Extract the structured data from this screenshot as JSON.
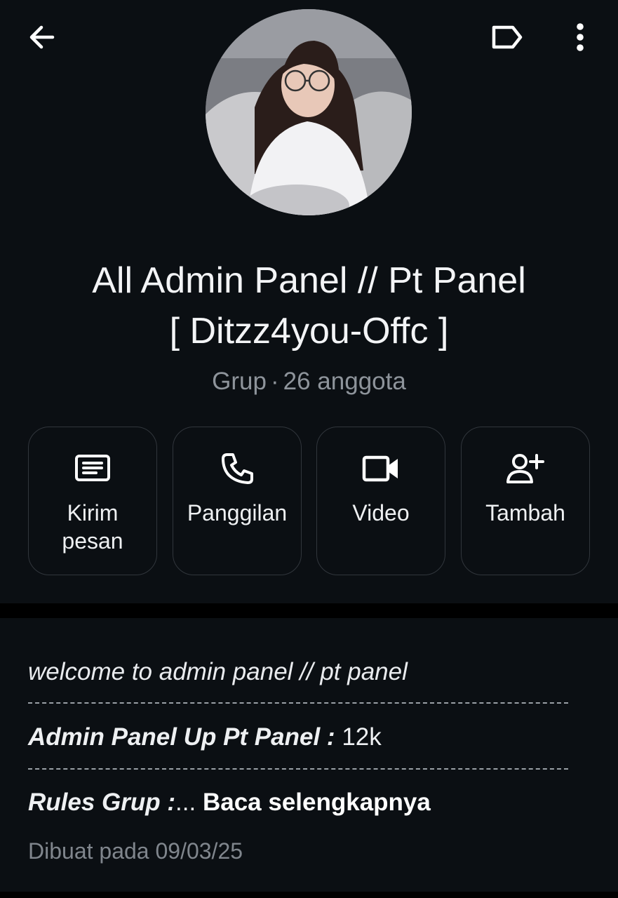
{
  "header": {
    "back_icon": "arrow-left-icon",
    "label_icon": "label-tag-icon",
    "more_icon": "more-vertical-icon"
  },
  "group": {
    "name_line1": "All Admin Panel // Pt Panel",
    "name_line2": "[ Ditzz4you-Offc ]",
    "type": "Grup",
    "separator": "·",
    "members": "26 anggota"
  },
  "actions": [
    {
      "label": "Kirim\npesan",
      "icon": "message-icon"
    },
    {
      "label": "Panggilan",
      "icon": "phone-icon"
    },
    {
      "label": "Video",
      "icon": "video-camera-icon"
    },
    {
      "label": "Tambah",
      "icon": "add-person-icon"
    }
  ],
  "description": {
    "line1": "welcome to admin panel // pt panel",
    "line2_label": "Admin Panel Up Pt Panel :",
    "line2_value": "12k",
    "line3_label": "Rules Grup :",
    "line3_ellipsis": "...",
    "read_more": "Baca selengkapnya",
    "created": "Dibuat pada 09/03/25"
  },
  "colors": {
    "background": "#0b0f13",
    "divider": "#000000",
    "secondary_text": "#8e949b",
    "button_border": "#31363c"
  }
}
